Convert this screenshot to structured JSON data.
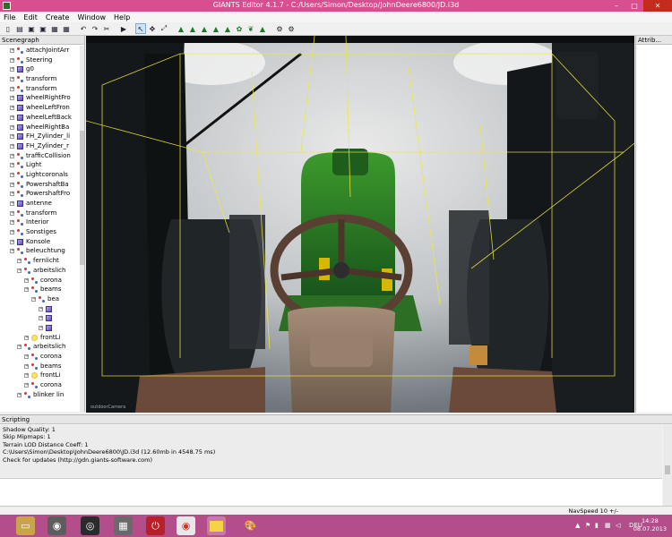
{
  "window": {
    "title": "GIANTS Editor 4.1.7 - C:/Users/Simon/Desktop/JohnDeere6800/JD.i3d",
    "minimize": "–",
    "maximize": "□",
    "close": "✕"
  },
  "menu": [
    "File",
    "Edit",
    "Create",
    "Window",
    "Help"
  ],
  "scenegraph": {
    "title": "Scenegraph",
    "nodes": [
      {
        "label": "attachJointArr",
        "icon": "transform-group",
        "indent": 1
      },
      {
        "label": "Steering",
        "icon": "transform-group",
        "indent": 1
      },
      {
        "label": "g0",
        "icon": "shape",
        "indent": 1
      },
      {
        "label": "transform",
        "icon": "transform-group",
        "indent": 1
      },
      {
        "label": "transform",
        "icon": "transform-group",
        "indent": 1
      },
      {
        "label": "wheelRightFro",
        "icon": "shape",
        "indent": 1
      },
      {
        "label": "wheelLeftFron",
        "icon": "shape",
        "indent": 1
      },
      {
        "label": "wheelLeftBack",
        "icon": "shape",
        "indent": 1
      },
      {
        "label": "wheelRightBa",
        "icon": "shape",
        "indent": 1
      },
      {
        "label": "FH_Zylinder_li",
        "icon": "shape",
        "indent": 1
      },
      {
        "label": "FH_Zylinder_r",
        "icon": "shape",
        "indent": 1
      },
      {
        "label": "trafficCollision",
        "icon": "transform-group",
        "indent": 1
      },
      {
        "label": "Light",
        "icon": "transform-group",
        "indent": 1
      },
      {
        "label": "Lightcoronals",
        "icon": "transform-group",
        "indent": 1
      },
      {
        "label": "PowershaftBa",
        "icon": "transform-group",
        "indent": 1
      },
      {
        "label": "PowershaftFro",
        "icon": "transform-group",
        "indent": 1
      },
      {
        "label": "antenne",
        "icon": "shape",
        "indent": 1
      },
      {
        "label": "transform",
        "icon": "transform-group",
        "indent": 1
      },
      {
        "label": "Interior",
        "icon": "transform-group",
        "indent": 1
      },
      {
        "label": "Sonstiges",
        "icon": "transform-group",
        "indent": 1
      },
      {
        "label": "Konsole",
        "icon": "shape",
        "indent": 1
      },
      {
        "label": "beleuchtung",
        "icon": "transform-group",
        "indent": 1
      },
      {
        "label": "fernlicht",
        "icon": "transform-group",
        "indent": 2
      },
      {
        "label": "arbeitslich",
        "icon": "transform-group",
        "indent": 2
      },
      {
        "label": "corona",
        "icon": "transform-group",
        "indent": 3
      },
      {
        "label": "beams",
        "icon": "transform-group",
        "indent": 3
      },
      {
        "label": "bea",
        "icon": "transform-group",
        "indent": 4
      },
      {
        "label": "",
        "icon": "shape",
        "indent": 5
      },
      {
        "label": "",
        "icon": "shape",
        "indent": 5
      },
      {
        "label": "",
        "icon": "shape",
        "indent": 5
      },
      {
        "label": "frontLi",
        "icon": "light",
        "indent": 3
      },
      {
        "label": "arbeitslich",
        "icon": "transform-group",
        "indent": 2
      },
      {
        "label": "corona",
        "icon": "transform-group",
        "indent": 3
      },
      {
        "label": "beams",
        "icon": "transform-group",
        "indent": 3
      },
      {
        "label": "frontLi",
        "icon": "light",
        "indent": 3
      },
      {
        "label": "corona",
        "icon": "transform-group",
        "indent": 3
      },
      {
        "label": "blinker lin",
        "icon": "transform-group",
        "indent": 2
      }
    ]
  },
  "viewport": {
    "camera_label": "outdoorCamera"
  },
  "attributes": {
    "title": "Attrib..."
  },
  "scripting": {
    "title": "Scripting",
    "log": [
      "  Shadow Quality: 1",
      "  Skip Mipmaps: 1",
      "  Terrain LOD Distance Coeff: 1",
      "C:\\Users\\Simon\\Desktop\\JohnDeere6800\\JD.i3d (12.60mb in 4548.75 ms)",
      "Check for updates (http://gdn.giants-software.com)"
    ]
  },
  "status": {
    "navspeed": "NavSpeed 10 +/-"
  },
  "taskbar": {
    "apps": [
      "file-explorer-icon",
      "webcam-icon",
      "media-player-icon",
      "remote-desktop-icon",
      "power-icon",
      "chrome-icon",
      "notes-icon",
      "paint-icon"
    ],
    "language": "DEU",
    "time": "14:28",
    "date": "08.07.2013"
  },
  "colors": {
    "titlebar": "#d84f8f",
    "taskbar": "#b44e8a",
    "tractor_green": "#2b7a23",
    "tractor_yellow": "#f2d600",
    "selection_lines": "#f0e83a"
  }
}
